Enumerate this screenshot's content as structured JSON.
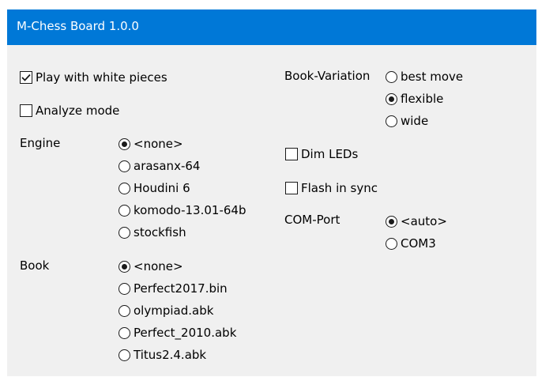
{
  "window": {
    "title": "M-Chess Board 1.0.0",
    "title_bar_color": "#0078d7",
    "background_color": "#f0f0f0"
  },
  "options": {
    "play_white": {
      "label": "Play with white pieces",
      "checked": true
    },
    "analyze_mode": {
      "label": "Analyze mode",
      "checked": false
    },
    "dim_leds": {
      "label": "Dim LEDs",
      "checked": false
    },
    "flash_sync": {
      "label": "Flash in sync",
      "checked": false
    }
  },
  "engine": {
    "label": "Engine",
    "selected": "<none>",
    "options": [
      "<none>",
      "arasanx-64",
      "Houdini 6",
      "komodo-13.01-64b",
      "stockfish"
    ]
  },
  "book": {
    "label": "Book",
    "selected": "<none>",
    "options": [
      "<none>",
      "Perfect2017.bin",
      "olympiad.abk",
      "Perfect_2010.abk",
      "Titus2.4.abk"
    ]
  },
  "book_variation": {
    "label": "Book-Variation",
    "selected": "flexible",
    "options": [
      "best move",
      "flexible",
      "wide"
    ]
  },
  "com_port": {
    "label": "COM-Port",
    "selected": "<auto>",
    "options": [
      "<auto>",
      "COM3"
    ]
  }
}
